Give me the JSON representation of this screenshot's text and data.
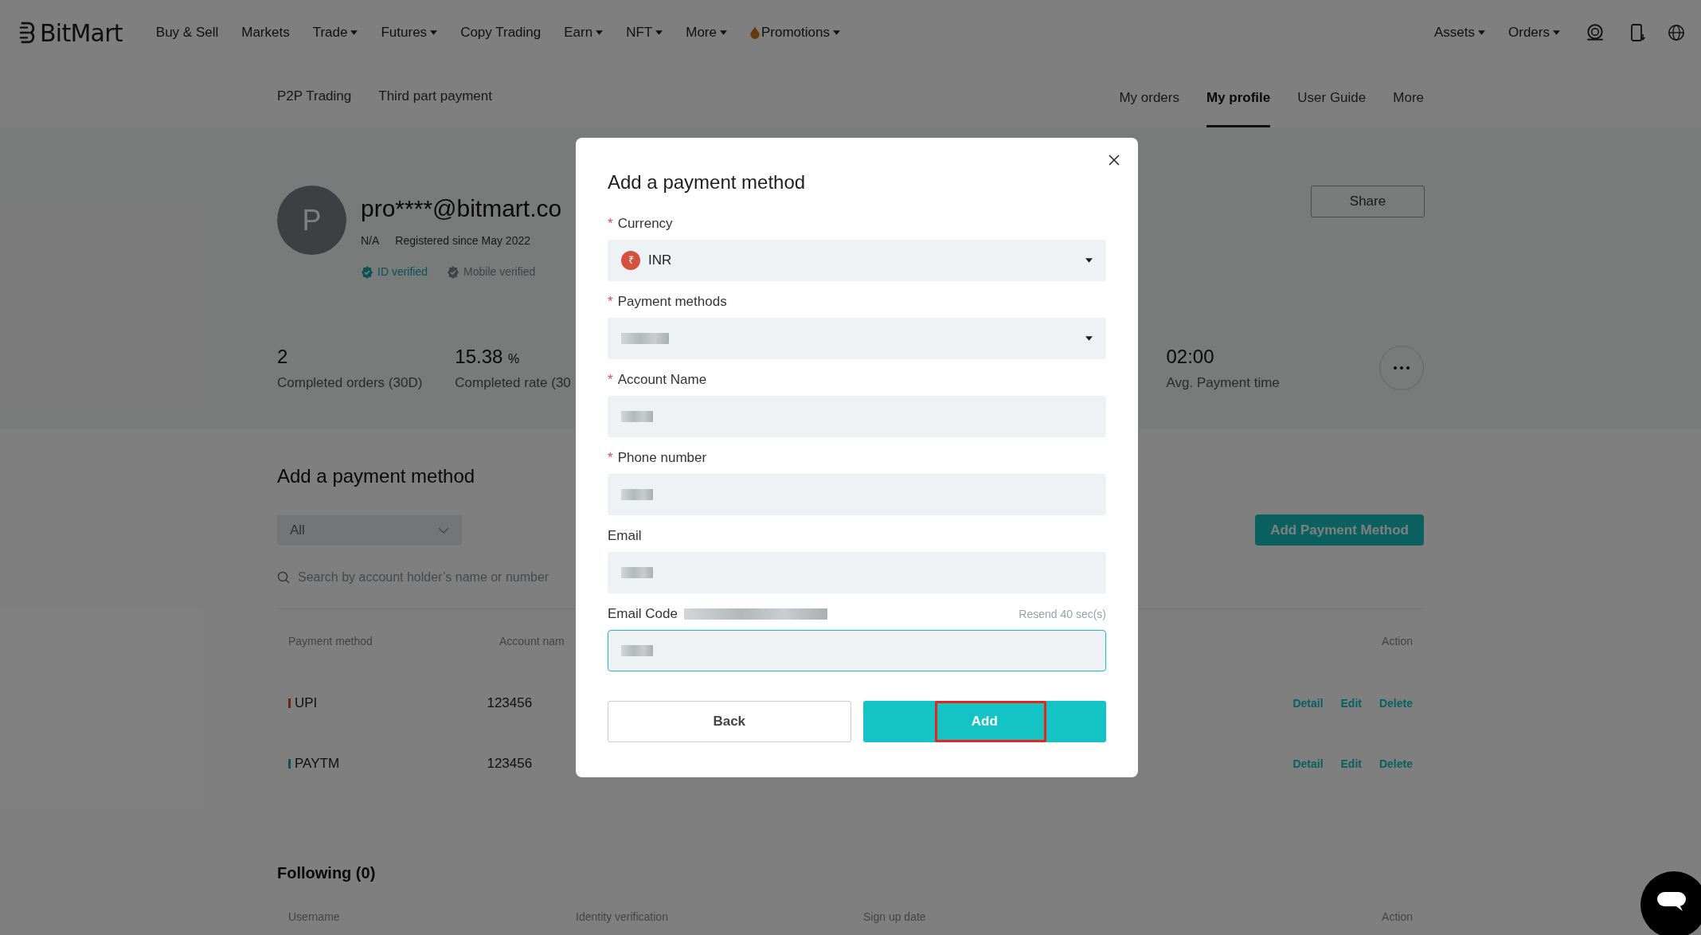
{
  "nav": {
    "logo": "BitMart",
    "items": [
      {
        "label": "Buy & Sell",
        "caret": false
      },
      {
        "label": "Markets",
        "caret": false
      },
      {
        "label": "Trade",
        "caret": true
      },
      {
        "label": "Futures",
        "caret": true
      },
      {
        "label": "Copy Trading",
        "caret": false
      },
      {
        "label": "Earn",
        "caret": true
      },
      {
        "label": "NFT",
        "caret": true
      },
      {
        "label": "More",
        "caret": true
      },
      {
        "label": "Promotions",
        "caret": true,
        "kind": "flame"
      }
    ],
    "right_items": [
      {
        "label": "Assets",
        "caret": true
      },
      {
        "label": "Orders",
        "caret": true
      }
    ]
  },
  "subnav": {
    "left": [
      {
        "label": "P2P Trading"
      },
      {
        "label": "Third part payment"
      }
    ],
    "right": [
      {
        "label": "My orders",
        "selected": false
      },
      {
        "label": "My profile",
        "selected": true
      },
      {
        "label": "User Guide",
        "selected": false
      },
      {
        "label": "More",
        "selected": false
      }
    ]
  },
  "profile": {
    "avatar_letter": "P",
    "email": "pro****@bitmart.co",
    "status": "N/A",
    "registered": "Registered since May 2022",
    "badges": [
      {
        "label": "ID verified",
        "verified": true
      },
      {
        "label": "Mobile verified",
        "verified": false
      }
    ],
    "share_button": "Share",
    "stats": [
      {
        "value": "2",
        "label": "Completed orders (30D)"
      },
      {
        "value": "15.38",
        "unit": "%",
        "label": "Completed rate (30"
      },
      {
        "value": "02:00",
        "label": "Avg. Payment time"
      }
    ]
  },
  "payment_section": {
    "title": "Add a payment method",
    "filter": {
      "value": "All"
    },
    "add_button": "Add Payment Method",
    "search": {
      "placeholder": "Search by account holder’s name or number"
    },
    "columns": [
      "Payment method",
      "Account nam",
      "Action"
    ],
    "rows": [
      {
        "method": "UPI",
        "color": "#6c240e",
        "account": "123456",
        "actions": [
          "Detail",
          "Edit",
          "Delete"
        ]
      },
      {
        "method": "PAYTM",
        "color": "#0d5353",
        "account": "123456",
        "actions": [
          "Detail",
          "Edit",
          "Delete"
        ]
      }
    ]
  },
  "following": {
    "title": "Following (0)",
    "columns": [
      "Username",
      "Identity verification",
      "Sign up date",
      "Action"
    ]
  },
  "modal": {
    "title": "Add a payment method",
    "fields": [
      {
        "label": "Currency",
        "required_mark": "*",
        "kind": "select",
        "currency_symbol": "₹",
        "value": "INR",
        "focused": false
      },
      {
        "label": "Payment methods",
        "required_mark": "*",
        "kind": "select",
        "redacted": true,
        "focused": false
      },
      {
        "label": "Account Name",
        "required_mark": "*",
        "kind": "input",
        "redacted": true,
        "focused": false
      },
      {
        "label": "Phone number",
        "required_mark": "*",
        "kind": "input",
        "redacted": true,
        "focused": false
      },
      {
        "label": "Email",
        "kind": "input",
        "redacted": true,
        "focused": false
      },
      {
        "label": "Email Code",
        "kind": "input",
        "redacted": true,
        "label_redacted": true,
        "aside": "Resend 40 sec(s)",
        "focused": true
      }
    ],
    "back_button": "Back",
    "add_button": {
      "label": "Add",
      "highlighted": true
    }
  }
}
